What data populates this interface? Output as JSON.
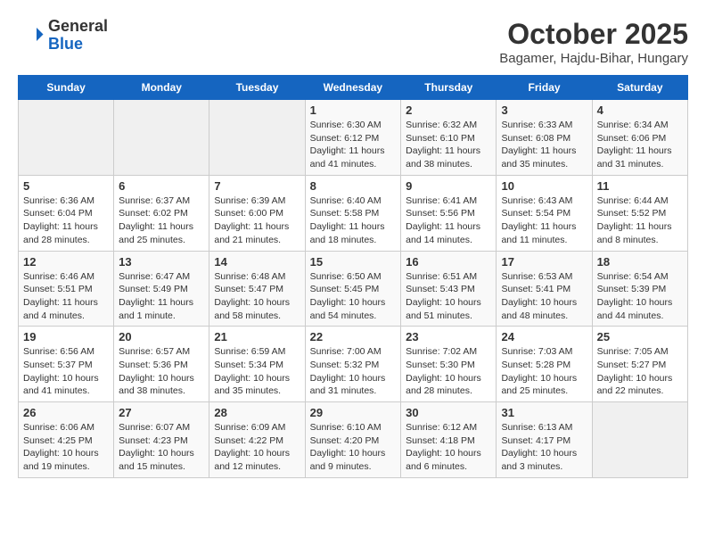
{
  "header": {
    "logo": {
      "general": "General",
      "blue": "Blue"
    },
    "title": "October 2025",
    "subtitle": "Bagamer, Hajdu-Bihar, Hungary"
  },
  "calendar": {
    "days_of_week": [
      "Sunday",
      "Monday",
      "Tuesday",
      "Wednesday",
      "Thursday",
      "Friday",
      "Saturday"
    ],
    "weeks": [
      [
        {
          "day": "",
          "info": ""
        },
        {
          "day": "",
          "info": ""
        },
        {
          "day": "",
          "info": ""
        },
        {
          "day": "1",
          "info": "Sunrise: 6:30 AM\nSunset: 6:12 PM\nDaylight: 11 hours and 41 minutes."
        },
        {
          "day": "2",
          "info": "Sunrise: 6:32 AM\nSunset: 6:10 PM\nDaylight: 11 hours and 38 minutes."
        },
        {
          "day": "3",
          "info": "Sunrise: 6:33 AM\nSunset: 6:08 PM\nDaylight: 11 hours and 35 minutes."
        },
        {
          "day": "4",
          "info": "Sunrise: 6:34 AM\nSunset: 6:06 PM\nDaylight: 11 hours and 31 minutes."
        }
      ],
      [
        {
          "day": "5",
          "info": "Sunrise: 6:36 AM\nSunset: 6:04 PM\nDaylight: 11 hours and 28 minutes."
        },
        {
          "day": "6",
          "info": "Sunrise: 6:37 AM\nSunset: 6:02 PM\nDaylight: 11 hours and 25 minutes."
        },
        {
          "day": "7",
          "info": "Sunrise: 6:39 AM\nSunset: 6:00 PM\nDaylight: 11 hours and 21 minutes."
        },
        {
          "day": "8",
          "info": "Sunrise: 6:40 AM\nSunset: 5:58 PM\nDaylight: 11 hours and 18 minutes."
        },
        {
          "day": "9",
          "info": "Sunrise: 6:41 AM\nSunset: 5:56 PM\nDaylight: 11 hours and 14 minutes."
        },
        {
          "day": "10",
          "info": "Sunrise: 6:43 AM\nSunset: 5:54 PM\nDaylight: 11 hours and 11 minutes."
        },
        {
          "day": "11",
          "info": "Sunrise: 6:44 AM\nSunset: 5:52 PM\nDaylight: 11 hours and 8 minutes."
        }
      ],
      [
        {
          "day": "12",
          "info": "Sunrise: 6:46 AM\nSunset: 5:51 PM\nDaylight: 11 hours and 4 minutes."
        },
        {
          "day": "13",
          "info": "Sunrise: 6:47 AM\nSunset: 5:49 PM\nDaylight: 11 hours and 1 minute."
        },
        {
          "day": "14",
          "info": "Sunrise: 6:48 AM\nSunset: 5:47 PM\nDaylight: 10 hours and 58 minutes."
        },
        {
          "day": "15",
          "info": "Sunrise: 6:50 AM\nSunset: 5:45 PM\nDaylight: 10 hours and 54 minutes."
        },
        {
          "day": "16",
          "info": "Sunrise: 6:51 AM\nSunset: 5:43 PM\nDaylight: 10 hours and 51 minutes."
        },
        {
          "day": "17",
          "info": "Sunrise: 6:53 AM\nSunset: 5:41 PM\nDaylight: 10 hours and 48 minutes."
        },
        {
          "day": "18",
          "info": "Sunrise: 6:54 AM\nSunset: 5:39 PM\nDaylight: 10 hours and 44 minutes."
        }
      ],
      [
        {
          "day": "19",
          "info": "Sunrise: 6:56 AM\nSunset: 5:37 PM\nDaylight: 10 hours and 41 minutes."
        },
        {
          "day": "20",
          "info": "Sunrise: 6:57 AM\nSunset: 5:36 PM\nDaylight: 10 hours and 38 minutes."
        },
        {
          "day": "21",
          "info": "Sunrise: 6:59 AM\nSunset: 5:34 PM\nDaylight: 10 hours and 35 minutes."
        },
        {
          "day": "22",
          "info": "Sunrise: 7:00 AM\nSunset: 5:32 PM\nDaylight: 10 hours and 31 minutes."
        },
        {
          "day": "23",
          "info": "Sunrise: 7:02 AM\nSunset: 5:30 PM\nDaylight: 10 hours and 28 minutes."
        },
        {
          "day": "24",
          "info": "Sunrise: 7:03 AM\nSunset: 5:28 PM\nDaylight: 10 hours and 25 minutes."
        },
        {
          "day": "25",
          "info": "Sunrise: 7:05 AM\nSunset: 5:27 PM\nDaylight: 10 hours and 22 minutes."
        }
      ],
      [
        {
          "day": "26",
          "info": "Sunrise: 6:06 AM\nSunset: 4:25 PM\nDaylight: 10 hours and 19 minutes."
        },
        {
          "day": "27",
          "info": "Sunrise: 6:07 AM\nSunset: 4:23 PM\nDaylight: 10 hours and 15 minutes."
        },
        {
          "day": "28",
          "info": "Sunrise: 6:09 AM\nSunset: 4:22 PM\nDaylight: 10 hours and 12 minutes."
        },
        {
          "day": "29",
          "info": "Sunrise: 6:10 AM\nSunset: 4:20 PM\nDaylight: 10 hours and 9 minutes."
        },
        {
          "day": "30",
          "info": "Sunrise: 6:12 AM\nSunset: 4:18 PM\nDaylight: 10 hours and 6 minutes."
        },
        {
          "day": "31",
          "info": "Sunrise: 6:13 AM\nSunset: 4:17 PM\nDaylight: 10 hours and 3 minutes."
        },
        {
          "day": "",
          "info": ""
        }
      ]
    ]
  }
}
